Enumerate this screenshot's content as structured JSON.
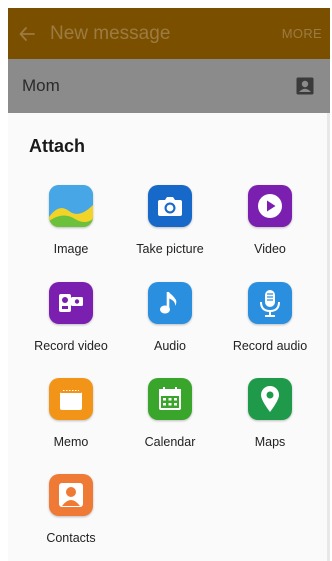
{
  "app_bar": {
    "title": "New message",
    "more_label": "MORE"
  },
  "recipient": {
    "name": "Mom"
  },
  "attach_sheet": {
    "title": "Attach",
    "items": [
      {
        "label": "Image",
        "icon": "image-icon",
        "color": "#4aa3e0"
      },
      {
        "label": "Take picture",
        "icon": "camera-icon",
        "color": "#1769c9"
      },
      {
        "label": "Video",
        "icon": "video-icon",
        "color": "#7a1fb0"
      },
      {
        "label": "Record video",
        "icon": "record-video-icon",
        "color": "#7a1fb0"
      },
      {
        "label": "Audio",
        "icon": "music-note-icon",
        "color": "#2b8fe0"
      },
      {
        "label": "Record audio",
        "icon": "microphone-icon",
        "color": "#2b8fe0"
      },
      {
        "label": "Memo",
        "icon": "memo-icon",
        "color": "#f29418"
      },
      {
        "label": "Calendar",
        "icon": "calendar-icon",
        "color": "#3aa52b"
      },
      {
        "label": "Maps",
        "icon": "map-pin-icon",
        "color": "#1f9a4a"
      },
      {
        "label": "Contacts",
        "icon": "contact-icon",
        "color": "#ef7a36"
      }
    ]
  }
}
